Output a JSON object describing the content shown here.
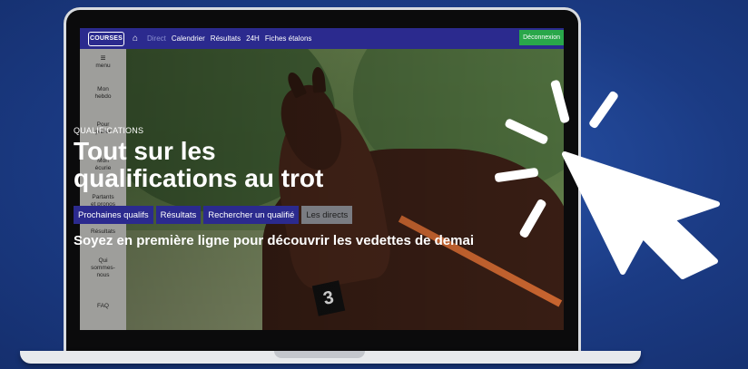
{
  "colors": {
    "background": "#1c3d86",
    "nav": "#2b2a8e",
    "logout": "#29a74a",
    "accent_strip": "#e8684a"
  },
  "nav": {
    "logo": "COURSES",
    "home_icon": "home-icon",
    "links": [
      "Direct",
      "Calendrier",
      "Résultats",
      "24H",
      "Fiches étalons"
    ],
    "logout": "Déconnexion"
  },
  "sidebar": {
    "menu_icon": "hamburger-icon",
    "menu_label": "menu",
    "items": [
      {
        "line1": "Mon",
        "line2": "hebdo",
        "line3": ""
      },
      {
        "line1": "Pour",
        "line2": "parier",
        "line3": ""
      },
      {
        "line1": "Mon",
        "line2": "écurie",
        "line3": ""
      },
      {
        "line1": "Partants",
        "line2": "et pronos",
        "line3": ""
      },
      {
        "line1": "Résultats",
        "line2": "",
        "line3": ""
      },
      {
        "line1": "Qui",
        "line2": "sommes-",
        "line3": "nous"
      },
      {
        "line1": "FAQ",
        "line2": "",
        "line3": ""
      }
    ]
  },
  "hero": {
    "eyebrow": "QUALIFICATIONS",
    "title_line1": "Tout sur les",
    "title_line2": "qualifications au trot",
    "buttons": [
      "Prochaines qualifs",
      "Résultats",
      "Rechercher un qualifié",
      "Les directs"
    ],
    "tagline": "Soyez en première ligne pour découvrir les vedettes de demai",
    "number_card": "3"
  },
  "decor": {
    "cursor_icon": "cursor-arrow-icon",
    "click_rays_icon": "click-rays-icon"
  }
}
